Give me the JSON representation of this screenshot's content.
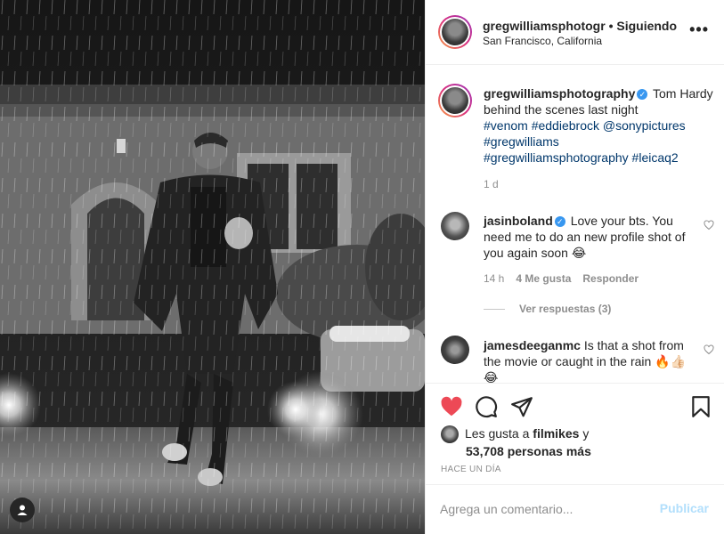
{
  "header": {
    "username": "gregwilliamsphotogr",
    "separator": "•",
    "follow_status": "Siguiendo",
    "location": "San Francisco, California",
    "more_label": "•••"
  },
  "caption": {
    "username": "gregwilliamsphotography",
    "text": "Tom Hardy behind the scenes last night",
    "tags": [
      "#venom",
      "#eddiebrock",
      "@sonypictures",
      "#gregwilliams",
      "#gregwilliamsphotography",
      "#leicaq2"
    ],
    "time": "1 d"
  },
  "comments": [
    {
      "username": "jasinboland",
      "verified": true,
      "text": "Love your bts. You need me to do an new profile shot of you again soon 😂",
      "time": "14 h",
      "likes": "4 Me gusta",
      "reply_label": "Responder",
      "view_replies": "Ver respuestas (3)"
    },
    {
      "username": "jamesdeeganmc",
      "verified": false,
      "text": "Is that a shot from the movie or caught in the rain 🔥👍🏻😂"
    }
  ],
  "likes": {
    "prefix": "Les gusta a",
    "first_user": "filmikes",
    "conjunction": "y",
    "others": "53,708 personas más"
  },
  "posted_ago": "HACE UN DÍA",
  "composer": {
    "placeholder": "Agrega un comentario...",
    "post_label": "Publicar"
  },
  "colors": {
    "like_heart": "#ed4956",
    "link": "#00376b",
    "verified": "#3897f0",
    "post_disabled": "#b2dffc",
    "muted": "#8e8e8e"
  },
  "icons": {
    "like": "heart-filled-icon",
    "comment": "comment-bubble-icon",
    "share": "paper-plane-icon",
    "save": "bookmark-icon",
    "tag": "user-tag-icon",
    "verified": "verified-badge-icon"
  }
}
